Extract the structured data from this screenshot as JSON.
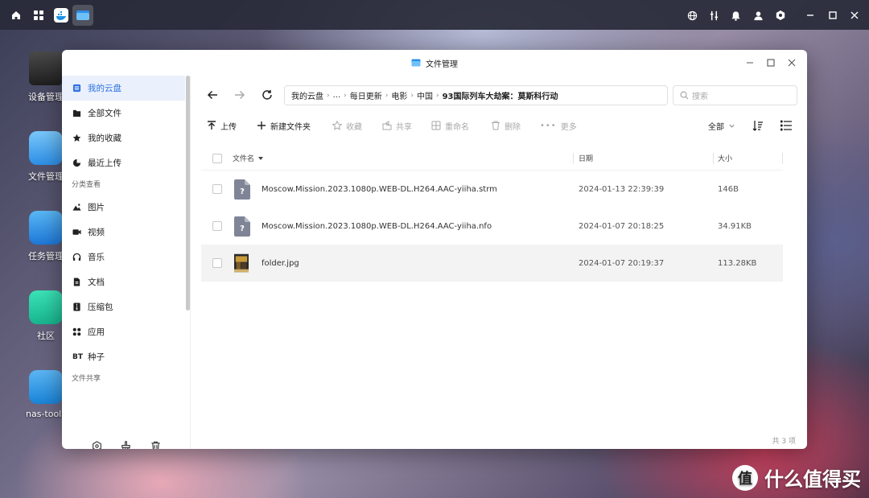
{
  "desktop": {
    "icons": [
      {
        "label": "设备管理"
      },
      {
        "label": "文件管理"
      },
      {
        "label": "任务管理"
      },
      {
        "label": "社区"
      },
      {
        "label": "nas-tools"
      }
    ],
    "watermark": "什么值得买"
  },
  "window": {
    "title": "文件管理"
  },
  "sidebar": {
    "items": [
      {
        "label": "我的云盘"
      },
      {
        "label": "全部文件"
      },
      {
        "label": "我的收藏"
      },
      {
        "label": "最近上传"
      }
    ],
    "section_category": "分类查看",
    "categories": [
      {
        "label": "图片"
      },
      {
        "label": "视频"
      },
      {
        "label": "音乐"
      },
      {
        "label": "文档"
      },
      {
        "label": "压缩包"
      },
      {
        "label": "应用"
      },
      {
        "label": "种子",
        "prefix": "BT"
      }
    ],
    "section_share": "文件共享"
  },
  "nav": {
    "breadcrumb": [
      "我的云盘",
      "...",
      "每日更新",
      "电影",
      "中国",
      "93国际列车大劫案：莫斯科行动"
    ],
    "search_placeholder": "搜索"
  },
  "toolbar": {
    "upload": "上传",
    "new_folder": "新建文件夹",
    "favorite": "收藏",
    "share": "共享",
    "rename": "重命名",
    "delete": "删除",
    "more": "更多",
    "filter": "全部"
  },
  "table": {
    "headers": {
      "name": "文件名",
      "date": "日期",
      "size": "大小"
    },
    "rows": [
      {
        "name": "Moscow.Mission.2023.1080p.WEB-DL.H264.AAC-yiiha.strm",
        "date": "2024-01-13 22:39:39",
        "size": "146B",
        "icon": "unknown-file-icon"
      },
      {
        "name": "Moscow.Mission.2023.1080p.WEB-DL.H264.AAC-yiiha.nfo",
        "date": "2024-01-07 20:18:25",
        "size": "34.91KB",
        "icon": "unknown-file-icon"
      },
      {
        "name": "folder.jpg",
        "date": "2024-01-07 20:19:37",
        "size": "113.28KB",
        "icon": "image-thumbnail"
      }
    ]
  },
  "footer": {
    "count": "共 3 项"
  },
  "colors": {
    "accent": "#2f6fe0",
    "selected_bg": "#eaf1fc"
  }
}
